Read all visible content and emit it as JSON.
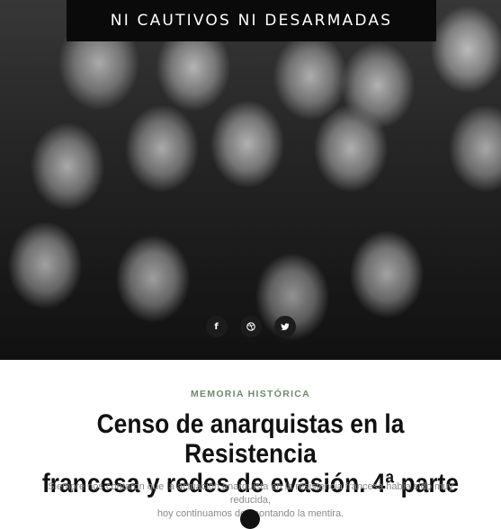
{
  "site": {
    "title": "NI CAUTIVOS NI DESARMADAS"
  },
  "share": {
    "facebook_glyph": "f",
    "twitter_glyph": "twitter-bird",
    "other_icon": "dribbble-icon"
  },
  "article": {
    "category": "MEMORIA HISTÓRICA",
    "title_line1": "Censo de anarquistas en la Resistencia",
    "title_line2": "francesa y redes de evasión. 4ª parte",
    "lead_line1": "Siempre nos contaron que la actuación anarquista en la resistencia francesa había sido muy reducida,",
    "lead_line2": "hoy continuamos desmontando la mentira."
  },
  "colors": {
    "accent_category": "#6f8a6d",
    "title_bar": "#0a0a0a"
  }
}
